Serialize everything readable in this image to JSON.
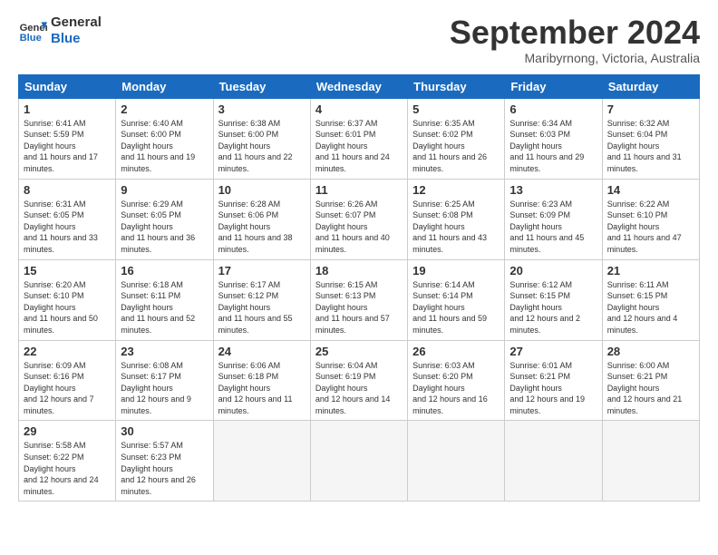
{
  "header": {
    "logo_general": "General",
    "logo_blue": "Blue",
    "month_title": "September 2024",
    "location": "Maribyrnong, Victoria, Australia"
  },
  "days_of_week": [
    "Sunday",
    "Monday",
    "Tuesday",
    "Wednesday",
    "Thursday",
    "Friday",
    "Saturday"
  ],
  "weeks": [
    [
      {
        "day": "1",
        "sunrise": "6:41 AM",
        "sunset": "5:59 PM",
        "daylight": "11 hours and 17 minutes."
      },
      {
        "day": "2",
        "sunrise": "6:40 AM",
        "sunset": "6:00 PM",
        "daylight": "11 hours and 19 minutes."
      },
      {
        "day": "3",
        "sunrise": "6:38 AM",
        "sunset": "6:00 PM",
        "daylight": "11 hours and 22 minutes."
      },
      {
        "day": "4",
        "sunrise": "6:37 AM",
        "sunset": "6:01 PM",
        "daylight": "11 hours and 24 minutes."
      },
      {
        "day": "5",
        "sunrise": "6:35 AM",
        "sunset": "6:02 PM",
        "daylight": "11 hours and 26 minutes."
      },
      {
        "day": "6",
        "sunrise": "6:34 AM",
        "sunset": "6:03 PM",
        "daylight": "11 hours and 29 minutes."
      },
      {
        "day": "7",
        "sunrise": "6:32 AM",
        "sunset": "6:04 PM",
        "daylight": "11 hours and 31 minutes."
      }
    ],
    [
      {
        "day": "8",
        "sunrise": "6:31 AM",
        "sunset": "6:05 PM",
        "daylight": "11 hours and 33 minutes."
      },
      {
        "day": "9",
        "sunrise": "6:29 AM",
        "sunset": "6:05 PM",
        "daylight": "11 hours and 36 minutes."
      },
      {
        "day": "10",
        "sunrise": "6:28 AM",
        "sunset": "6:06 PM",
        "daylight": "11 hours and 38 minutes."
      },
      {
        "day": "11",
        "sunrise": "6:26 AM",
        "sunset": "6:07 PM",
        "daylight": "11 hours and 40 minutes."
      },
      {
        "day": "12",
        "sunrise": "6:25 AM",
        "sunset": "6:08 PM",
        "daylight": "11 hours and 43 minutes."
      },
      {
        "day": "13",
        "sunrise": "6:23 AM",
        "sunset": "6:09 PM",
        "daylight": "11 hours and 45 minutes."
      },
      {
        "day": "14",
        "sunrise": "6:22 AM",
        "sunset": "6:10 PM",
        "daylight": "11 hours and 47 minutes."
      }
    ],
    [
      {
        "day": "15",
        "sunrise": "6:20 AM",
        "sunset": "6:10 PM",
        "daylight": "11 hours and 50 minutes."
      },
      {
        "day": "16",
        "sunrise": "6:18 AM",
        "sunset": "6:11 PM",
        "daylight": "11 hours and 52 minutes."
      },
      {
        "day": "17",
        "sunrise": "6:17 AM",
        "sunset": "6:12 PM",
        "daylight": "11 hours and 55 minutes."
      },
      {
        "day": "18",
        "sunrise": "6:15 AM",
        "sunset": "6:13 PM",
        "daylight": "11 hours and 57 minutes."
      },
      {
        "day": "19",
        "sunrise": "6:14 AM",
        "sunset": "6:14 PM",
        "daylight": "11 hours and 59 minutes."
      },
      {
        "day": "20",
        "sunrise": "6:12 AM",
        "sunset": "6:15 PM",
        "daylight": "12 hours and 2 minutes."
      },
      {
        "day": "21",
        "sunrise": "6:11 AM",
        "sunset": "6:15 PM",
        "daylight": "12 hours and 4 minutes."
      }
    ],
    [
      {
        "day": "22",
        "sunrise": "6:09 AM",
        "sunset": "6:16 PM",
        "daylight": "12 hours and 7 minutes."
      },
      {
        "day": "23",
        "sunrise": "6:08 AM",
        "sunset": "6:17 PM",
        "daylight": "12 hours and 9 minutes."
      },
      {
        "day": "24",
        "sunrise": "6:06 AM",
        "sunset": "6:18 PM",
        "daylight": "12 hours and 11 minutes."
      },
      {
        "day": "25",
        "sunrise": "6:04 AM",
        "sunset": "6:19 PM",
        "daylight": "12 hours and 14 minutes."
      },
      {
        "day": "26",
        "sunrise": "6:03 AM",
        "sunset": "6:20 PM",
        "daylight": "12 hours and 16 minutes."
      },
      {
        "day": "27",
        "sunrise": "6:01 AM",
        "sunset": "6:21 PM",
        "daylight": "12 hours and 19 minutes."
      },
      {
        "day": "28",
        "sunrise": "6:00 AM",
        "sunset": "6:21 PM",
        "daylight": "12 hours and 21 minutes."
      }
    ],
    [
      {
        "day": "29",
        "sunrise": "5:58 AM",
        "sunset": "6:22 PM",
        "daylight": "12 hours and 24 minutes."
      },
      {
        "day": "30",
        "sunrise": "5:57 AM",
        "sunset": "6:23 PM",
        "daylight": "12 hours and 26 minutes."
      },
      null,
      null,
      null,
      null,
      null
    ]
  ]
}
